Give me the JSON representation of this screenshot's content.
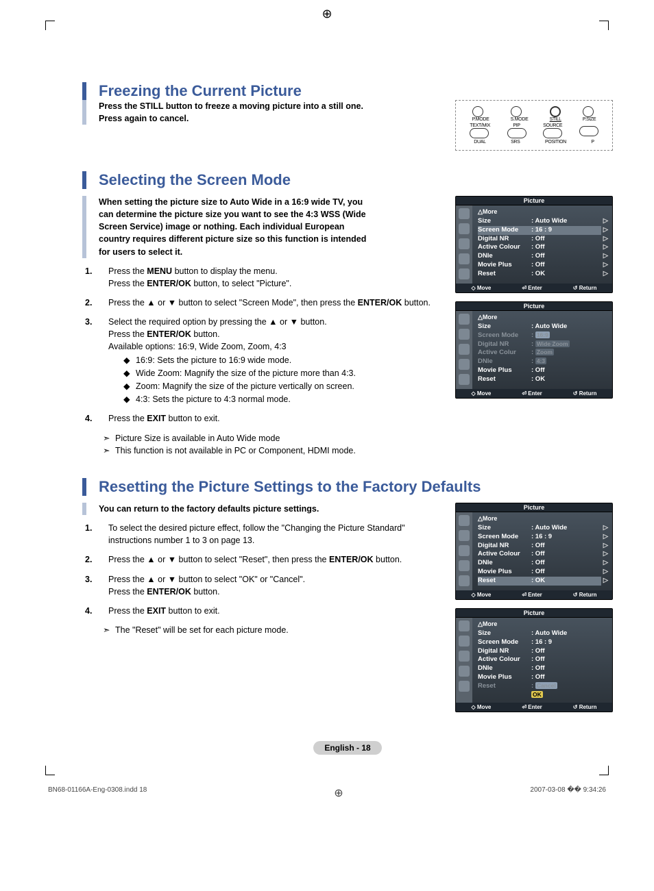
{
  "section1": {
    "title": "Freezing the Current Picture",
    "intro": "Press the STILL button to freeze a moving picture into a still one. Press again to cancel.",
    "remote_labels": [
      "P.MODE",
      "S.MODE",
      "STILL",
      "P.SIZE",
      "TEXT/MIX",
      "PIP",
      "SOURCE",
      "DUAL",
      "SRS",
      "POSITION",
      "P"
    ]
  },
  "section2": {
    "title": "Selecting the Screen Mode",
    "intro": "When setting the picture size to Auto Wide in a 16:9 wide TV, you can determine the picture size you want to see the 4:3 WSS (Wide Screen Service) image or nothing. Each individual European country requires different picture size so this function is intended for users to select it.",
    "step1_a": "Press the ",
    "step1_menu": "MENU",
    "step1_b": " button to display the menu.",
    "step1_c": "Press the ",
    "step1_enter": "ENTER/OK",
    "step1_d": " button, to select \"Picture\".",
    "step2_a": "Press the ▲ or ▼ button to select \"Screen Mode\", then press the ",
    "step2_enter": "ENTER/OK",
    "step2_b": " button.",
    "step3_a": "Select the required option by pressing the ▲ or ▼ button.",
    "step3_b": "Press the ",
    "step3_enter": "ENTER/OK",
    "step3_c": " button.",
    "step3_avail": "Available options: 16:9, Wide Zoom, Zoom, 4:3",
    "step3_bul1": "16:9: Sets the picture to 16:9 wide mode.",
    "step3_bul2": "Wide Zoom: Magnify the size of the picture more than 4:3.",
    "step3_bul3": "Zoom: Magnify the size of the picture vertically on screen.",
    "step3_bul4": "4:3: Sets the picture to 4:3 normal mode.",
    "step4_a": "Press the ",
    "step4_exit": "EXIT",
    "step4_b": " button to exit.",
    "note1": "Picture Size is available in Auto Wide mode",
    "note2": "This function is not available in PC or Component, HDMI mode.",
    "osd1": {
      "title": "Picture",
      "more": "△More",
      "rows": [
        {
          "l": "Size",
          "v": ": Auto Wide",
          "tri": "▷"
        },
        {
          "l": "Screen Mode",
          "v": ": 16 : 9",
          "tri": "▷",
          "sel": true
        },
        {
          "l": "Digital NR",
          "v": ": Off",
          "tri": "▷"
        },
        {
          "l": "Active Colour",
          "v": ": Off",
          "tri": "▷"
        },
        {
          "l": "DNIe",
          "v": ": Off",
          "tri": "▷"
        },
        {
          "l": "Movie Plus",
          "v": ": Off",
          "tri": "▷"
        },
        {
          "l": "Reset",
          "v": ": OK",
          "tri": "▷"
        }
      ],
      "footer": [
        "◇ Move",
        "⏎ Enter",
        "↺ Return"
      ]
    },
    "osd2": {
      "title": "Picture",
      "more": "△More",
      "rows": [
        {
          "l": "Size",
          "v": ": Auto Wide"
        },
        {
          "l": "Screen Mode",
          "v": ":",
          "opt": "16:9",
          "optsel": true,
          "grey": true
        },
        {
          "l": "Digital NR",
          "v": ":",
          "opt": "Wide Zoom",
          "grey": true
        },
        {
          "l": "Active Colur",
          "v": ":",
          "opt": "Zoom",
          "grey": true
        },
        {
          "l": "DNIe",
          "v": ":",
          "opt": "4:3",
          "grey": true
        },
        {
          "l": "Movie Plus",
          "v": ": Off"
        },
        {
          "l": "Reset",
          "v": ": OK"
        }
      ],
      "footer": [
        "◇ Move",
        "⏎ Enter",
        "↺ Return"
      ]
    }
  },
  "section3": {
    "title": "Resetting the Picture Settings to the Factory Defaults",
    "intro": "You can return to the factory defaults picture settings.",
    "step1_a": "To select the desired picture effect, follow the \"Changing the Picture Standard\" instructions number 1 to 3 on page 13.",
    "step2_a": "Press the ▲ or ▼ button to select \"Reset\", then press the ",
    "step2_enter": "ENTER/OK",
    "step2_b": " button.",
    "step3_a": "Press the ▲ or ▼ button to select \"OK\" or \"Cancel\".",
    "step3_b": "Press the ",
    "step3_enter": "ENTER/OK",
    "step3_c": " button.",
    "step4_a": "Press the ",
    "step4_exit": "EXIT",
    "step4_b": " button to exit.",
    "note1": "The \"Reset\" will be set for each picture mode.",
    "osd1": {
      "title": "Picture",
      "more": "△More",
      "rows": [
        {
          "l": "Size",
          "v": ": Auto Wide",
          "tri": "▷"
        },
        {
          "l": "Screen Mode",
          "v": ": 16 : 9",
          "tri": "▷"
        },
        {
          "l": "Digital NR",
          "v": ": Off",
          "tri": "▷"
        },
        {
          "l": "Active Colour",
          "v": ": Off",
          "tri": "▷"
        },
        {
          "l": "DNIe",
          "v": ": Off",
          "tri": "▷"
        },
        {
          "l": "Movie Plus",
          "v": ": Off",
          "tri": "▷"
        },
        {
          "l": "Reset",
          "v": ": OK",
          "tri": "▷",
          "sel": true
        }
      ],
      "footer": [
        "◇ Move",
        "⏎ Enter",
        "↺ Return"
      ]
    },
    "osd2": {
      "title": "Picture",
      "more": "△More",
      "rows": [
        {
          "l": "Size",
          "v": ": Auto Wide"
        },
        {
          "l": "Screen Mode",
          "v": ": 16 : 9"
        },
        {
          "l": "Digital NR",
          "v": ": Off"
        },
        {
          "l": "Active Colour",
          "v": ": Off"
        },
        {
          "l": "DNIe",
          "v": ": Off"
        },
        {
          "l": "Movie Plus",
          "v": ": Off"
        },
        {
          "l": "Reset",
          "v": ":",
          "opt": "Cancel",
          "optsel": true,
          "grey": true
        },
        {
          "l": "",
          "v": "",
          "opt": "OK",
          "ok": true
        }
      ],
      "footer": [
        "◇ Move",
        "⏎ Enter",
        "↺ Return"
      ]
    }
  },
  "pagelabel": "English - 18",
  "footer": {
    "left": "BN68-01166A-Eng-0308.indd   18",
    "right": "2007-03-08   �� 9:34:26"
  }
}
